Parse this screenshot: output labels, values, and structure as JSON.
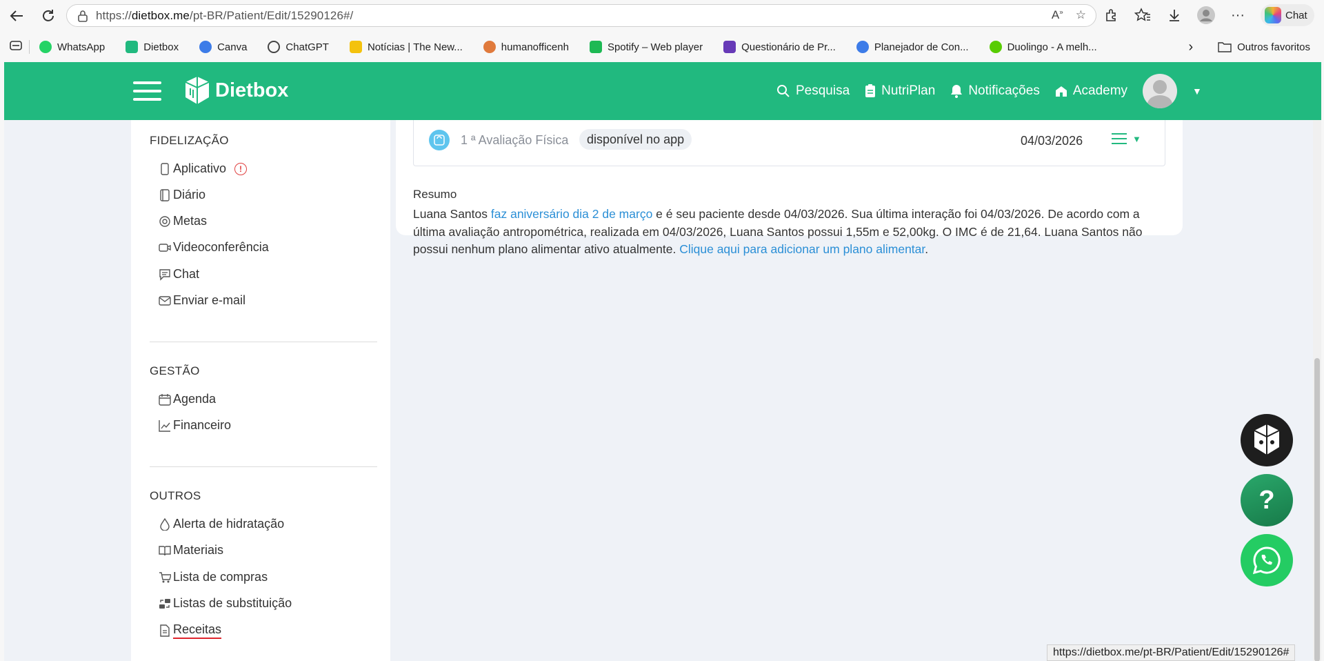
{
  "browser": {
    "url_prefix": "https://",
    "url_domain": "dietbox.me",
    "url_path": "/pt-BR/Patient/Edit/15290126#/",
    "chat_label": "Chat",
    "status_url": "https://dietbox.me/pt-BR/Patient/Edit/15290126#"
  },
  "bookmarks": [
    {
      "label": "WhatsApp",
      "color": "#25d366"
    },
    {
      "label": "Dietbox",
      "color": "#21b97f"
    },
    {
      "label": "Canva",
      "color": "#3d7ce8"
    },
    {
      "label": "ChatGPT",
      "color": "#444444"
    },
    {
      "label": "Notícias | The New...",
      "color": "#f4c20d"
    },
    {
      "label": "humanofficenh",
      "color": "#e07a3c"
    },
    {
      "label": "Spotify – Web player",
      "color": "#1db954"
    },
    {
      "label": "Questionário de Pr...",
      "color": "#673ab7"
    },
    {
      "label": "Planejador de Con...",
      "color": "#3d7ce8"
    },
    {
      "label": "Duolingo - A melh...",
      "color": "#58cc02"
    }
  ],
  "bookmarks_other": "Outros favoritos",
  "header": {
    "logo": "Dietbox",
    "nav": {
      "search": "Pesquisa",
      "nutriplan": "NutriPlan",
      "notifications": "Notificações",
      "academy": "Academy"
    }
  },
  "sidebar": {
    "fidelizacao": {
      "title": "FIDELIZAÇÃO",
      "items": [
        "Aplicativo",
        "Diário",
        "Metas",
        "Videoconferência",
        "Chat",
        "Enviar e-mail"
      ]
    },
    "gestao": {
      "title": "GESTÃO",
      "items": [
        "Agenda",
        "Financeiro"
      ]
    },
    "outros": {
      "title": "OUTROS",
      "items": [
        "Alerta de hidratação",
        "Materiais",
        "Lista de compras",
        "Listas de substituição",
        "Receitas"
      ]
    }
  },
  "evaluation": {
    "title": "1 ª Avaliação Física",
    "badge": "disponível no app",
    "date": "04/03/2026"
  },
  "resumo": {
    "title": "Resumo",
    "t1": "Luana Santos ",
    "link1": "faz aniversário dia 2 de março",
    "t2": " e é seu paciente desde 04/03/2026. Sua última interação foi 04/03/2026. De acordo com a última avaliação antropométrica, realizada em 04/03/2026, Luana Santos possui 1,55m e 52,00kg. O IMC é de 21,64. Luana Santos não possui nenhum plano alimentar ativo atualmente. ",
    "link2": "Clique aqui para adicionar um plano alimentar",
    "t3": "."
  },
  "help_label": "?",
  "colors": {
    "brand": "#21b97f",
    "link": "#2b8fd6",
    "alert": "#e04040"
  }
}
